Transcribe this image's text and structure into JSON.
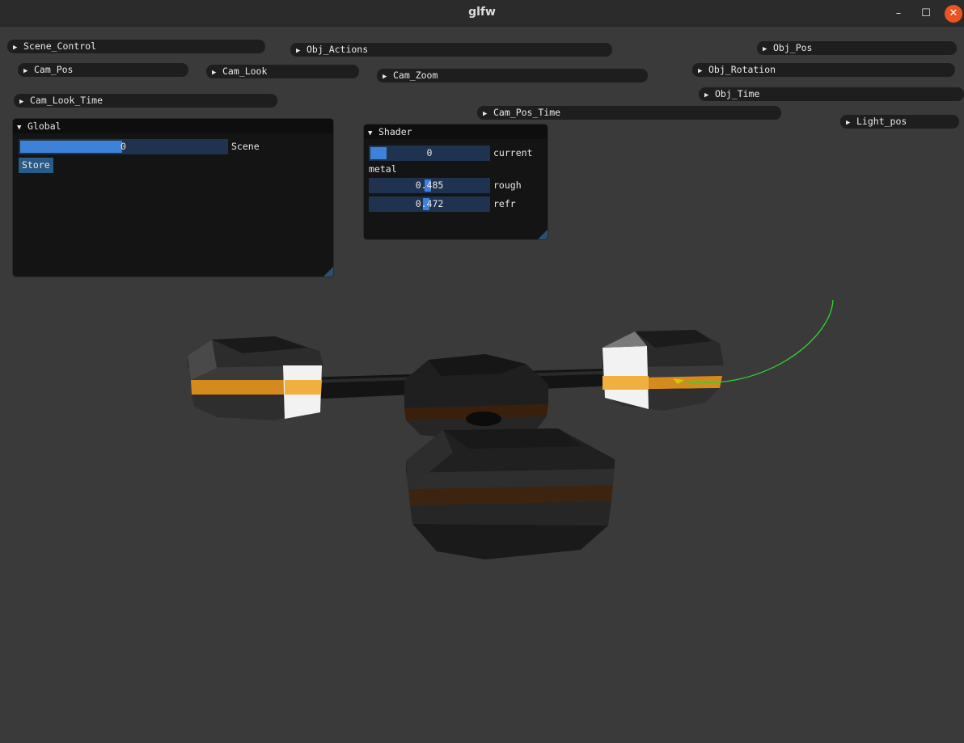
{
  "window": {
    "title": "glfw",
    "minimize": "–",
    "maximize": "☐",
    "close": "✕"
  },
  "collapse_arrow": "▶",
  "expand_arrow": "▼",
  "collapsed_panels": {
    "scene_control": "Scene_Control",
    "obj_actions": "Obj_Actions",
    "obj_pos": "Obj_Pos",
    "cam_pos": "Cam_Pos",
    "cam_look": "Cam_Look",
    "cam_zoom": "Cam_Zoom",
    "obj_rotation": "Obj_Rotation",
    "obj_time": "Obj_Time",
    "cam_look_time": "Cam_Look_Time",
    "cam_pos_time": "Cam_Pos_Time",
    "light_pos": "Light_pos"
  },
  "global_panel": {
    "title": "Global",
    "scene_slider": {
      "value": "0",
      "label": "Scene"
    },
    "store_button": "Store"
  },
  "shader_panel": {
    "title": "Shader",
    "current_slider": {
      "value": "0",
      "label": "current"
    },
    "metal_label": "metal",
    "rough_slider": {
      "value": "0.485",
      "label": "rough"
    },
    "refr_slider": {
      "value": "0.472",
      "label": "refr"
    }
  },
  "colors": {
    "background": "#3a3a3a",
    "panel": "#141414",
    "header": "#1e1e1e",
    "slider_track": "#1f3350",
    "slider_fill": "#3d82d8",
    "button": "#2a5a86",
    "close_button": "#e95420",
    "accent_orange": "#d48a1c",
    "trajectory_line": "#2fd62f"
  }
}
